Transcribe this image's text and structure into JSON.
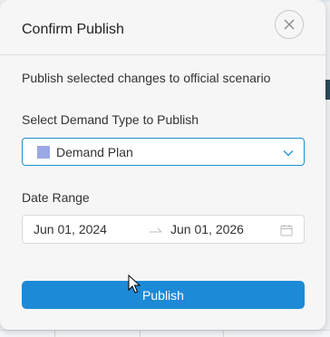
{
  "dialog": {
    "title": "Confirm Publish",
    "message": "Publish selected changes to official scenario"
  },
  "demand_type": {
    "label": "Select Demand Type to Publish",
    "selected": "Demand Plan",
    "swatch_color": "#9aa8e6"
  },
  "date_range": {
    "label": "Date Range",
    "start": "Jun 01, 2024",
    "end": "Jun 01, 2026"
  },
  "actions": {
    "publish_label": "Publish"
  },
  "colors": {
    "accent": "#1c8ad6",
    "focus_border": "#1a8fd6"
  }
}
